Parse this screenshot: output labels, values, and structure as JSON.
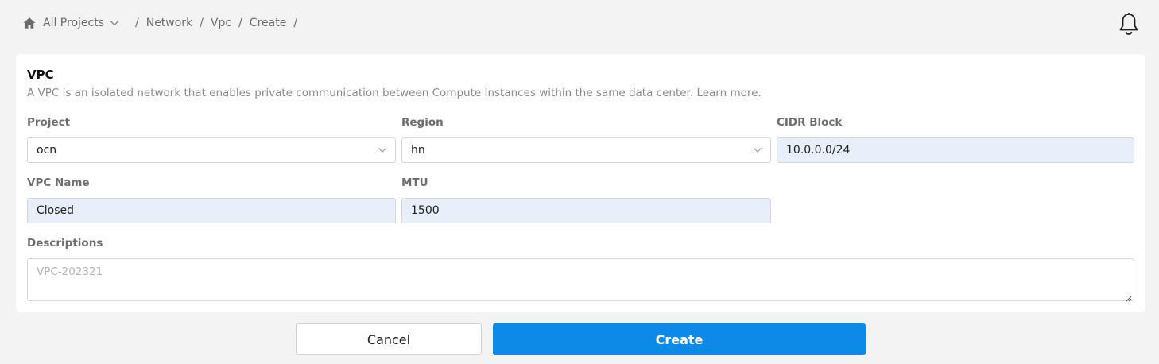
{
  "breadcrumb": {
    "project_selector": "All Projects",
    "items": [
      "Network",
      "Vpc",
      "Create"
    ],
    "separator": "/"
  },
  "icons": {
    "home": "home-icon",
    "chevron": "chevron-down-icon",
    "bell": "bell-icon"
  },
  "form": {
    "title": "VPC",
    "description": "A VPC is an isolated network that enables private communication between Compute Instances within the same data center. Learn more.",
    "project": {
      "label": "Project",
      "value": "ocn"
    },
    "region": {
      "label": "Region",
      "value": "hn"
    },
    "cidr": {
      "label": "CIDR Block",
      "value": "10.0.0.0/24"
    },
    "vpc_name": {
      "label": "VPC Name",
      "value": "Closed"
    },
    "mtu": {
      "label": "MTU",
      "value": "1500"
    },
    "descriptions": {
      "label": "Descriptions",
      "placeholder": "VPC-202321"
    }
  },
  "actions": {
    "cancel_label": "Cancel",
    "create_label": "Create"
  },
  "colors": {
    "primary": "#0d8ae8",
    "autofill_bg": "#e8effa",
    "page_bg": "#f3f3f3"
  }
}
